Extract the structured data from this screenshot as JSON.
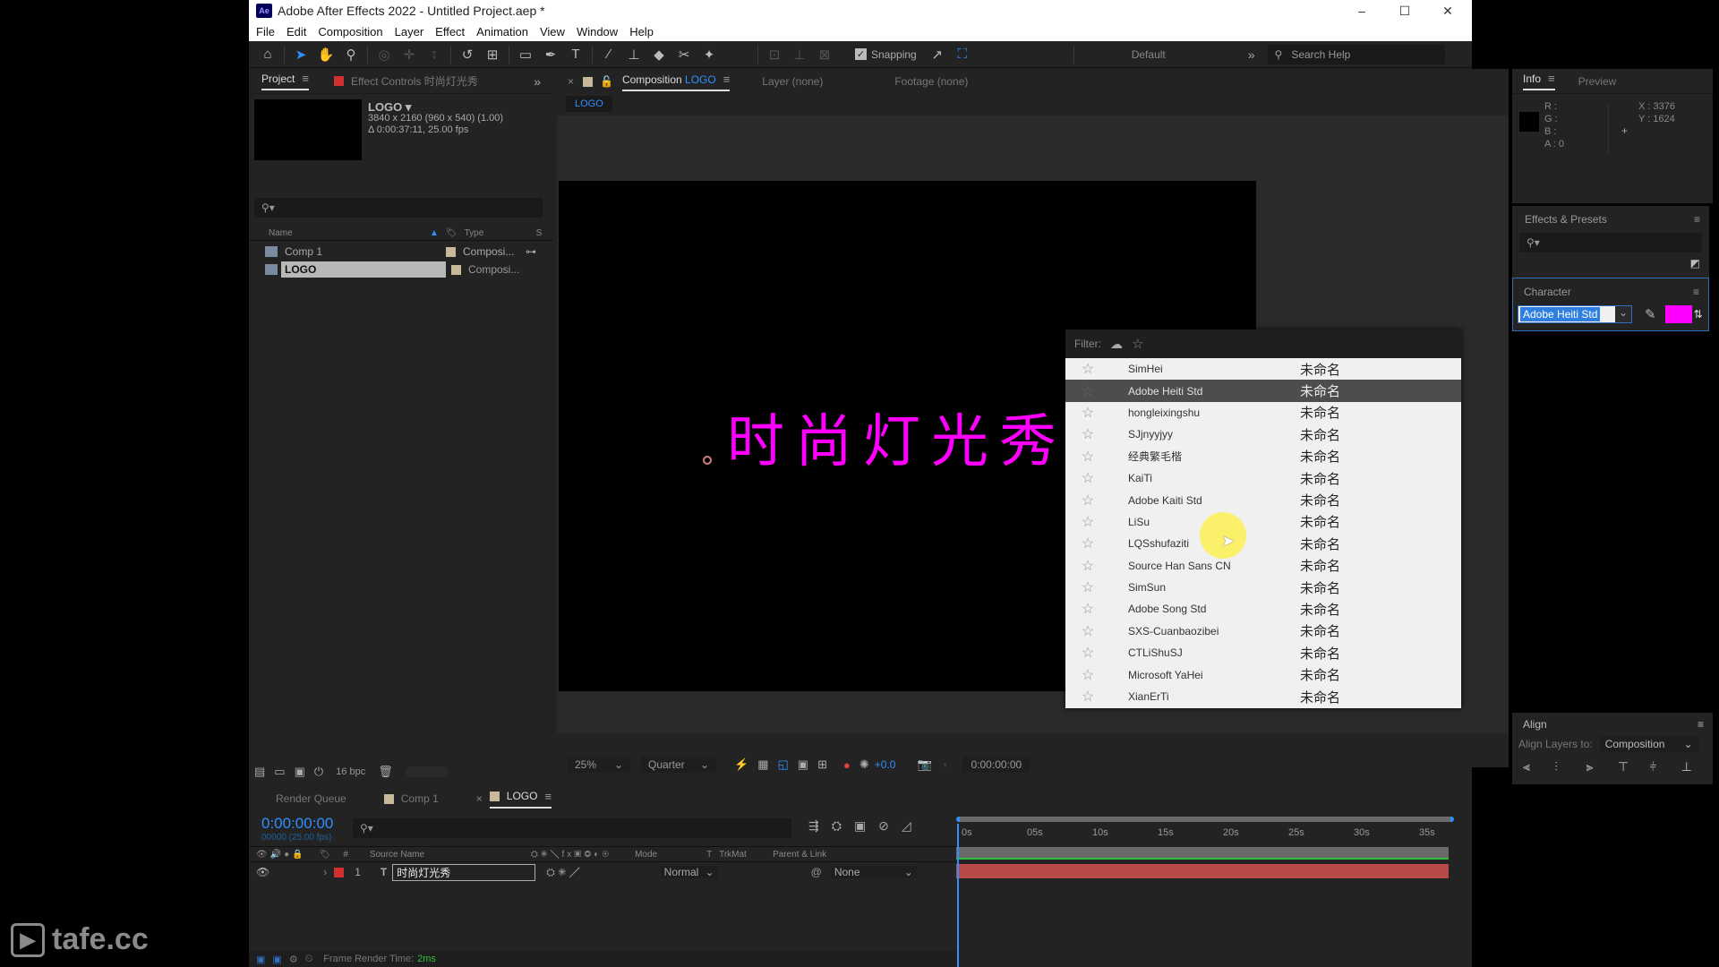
{
  "window": {
    "app_icon": "Ae",
    "title": "Adobe After Effects 2022 - Untitled Project.aep *",
    "controls": {
      "minimize": "–",
      "maximize": "☐",
      "close": "✕"
    }
  },
  "menu": [
    "File",
    "Edit",
    "Composition",
    "Layer",
    "Effect",
    "Animation",
    "View",
    "Window",
    "Help"
  ],
  "toolbar": {
    "snapping_label": "Snapping",
    "snapping_checked": true,
    "workspace": "Default",
    "overflow": "»",
    "search_help_placeholder": "Search Help"
  },
  "project_panel": {
    "tab_project": "Project",
    "tab_effect_controls": "Effect Controls 时尚灯光秀",
    "overflow": "»",
    "comp_name": "LOGO ▾",
    "comp_res": "3840 x 2160  (960 x 540) (1.00)",
    "comp_duration": "Δ 0:00:37:11, 25.00 fps",
    "columns": {
      "name": "Name",
      "type": "Type",
      "size": "S"
    },
    "items": [
      {
        "name": "Comp 1",
        "type": "Composi...",
        "selected": false
      },
      {
        "name": "LOGO",
        "type": "Composi...",
        "selected": true
      }
    ],
    "bpc": "16 bpc"
  },
  "viewer": {
    "tab_composition": "Composition",
    "tab_composition_name": "LOGO",
    "tab_layer": "Layer (none)",
    "tab_footage": "Footage (none)",
    "breadcrumb": "LOGO",
    "canvas_text": "时尚灯光秀",
    "text_color": "#ff00ff",
    "zoom": "25%",
    "resolution": "Quarter",
    "exposure": "+0.0",
    "timecode": "0:00:00:00"
  },
  "info_panel": {
    "tab_info": "Info",
    "tab_preview": "Preview",
    "r": "R :",
    "g": "G :",
    "b": "B :",
    "a": "A : 0",
    "x": "X : 3376",
    "y": "Y : 1624"
  },
  "effects_presets": {
    "title": "Effects & Presets"
  },
  "character": {
    "title": "Character",
    "font": "Adobe Heiti Std",
    "fill_color": "#ff00ff"
  },
  "font_dropdown": {
    "filter_label": "Filter:",
    "preview_text": "未命名",
    "fonts": [
      {
        "name": "SimHei",
        "selected": false
      },
      {
        "name": "Adobe Heiti Std",
        "selected": true
      },
      {
        "name": "hongleixingshu",
        "selected": false
      },
      {
        "name": "SJjnyyjyy",
        "selected": false
      },
      {
        "name": "经典繁毛楷",
        "selected": false
      },
      {
        "name": "KaiTi",
        "selected": false
      },
      {
        "name": "Adobe Kaiti Std",
        "selected": false
      },
      {
        "name": "LiSu",
        "selected": false
      },
      {
        "name": "LQSshufaziti",
        "selected": false
      },
      {
        "name": "Source Han Sans CN",
        "selected": false
      },
      {
        "name": "SimSun",
        "selected": false
      },
      {
        "name": "Adobe Song Std",
        "selected": false
      },
      {
        "name": "SXS-Cuanbaozibei",
        "selected": false
      },
      {
        "name": "CTLiShuSJ",
        "selected": false
      },
      {
        "name": "Microsoft YaHei",
        "selected": false
      },
      {
        "name": "XianErTi",
        "selected": false
      }
    ]
  },
  "align_panel": {
    "title": "Align",
    "align_to_label": "Align Layers to:",
    "align_to_value": "Composition"
  },
  "timeline": {
    "tab_render_queue": "Render Queue",
    "tab_comp1": "Comp 1",
    "tab_logo": "LOGO",
    "current_time": "0:00:00:00",
    "frame_info": "00000 (25.00 fps)",
    "columns": {
      "source_name": "Source Name",
      "mode": "Mode",
      "t": "T",
      "trkmat": "TrkMat",
      "parent": "Parent & Link",
      "num": "#"
    },
    "layers": [
      {
        "index": "1",
        "type_icon": "T",
        "name": "时尚灯光秀",
        "mode": "Normal",
        "parent": "None",
        "label_color": "#d03030"
      }
    ],
    "ruler": [
      "0s",
      "05s",
      "10s",
      "15s",
      "20s",
      "25s",
      "30s",
      "35s"
    ],
    "status_label": "Frame Render Time:",
    "status_value": "2ms"
  },
  "watermark": "tafe.cc"
}
